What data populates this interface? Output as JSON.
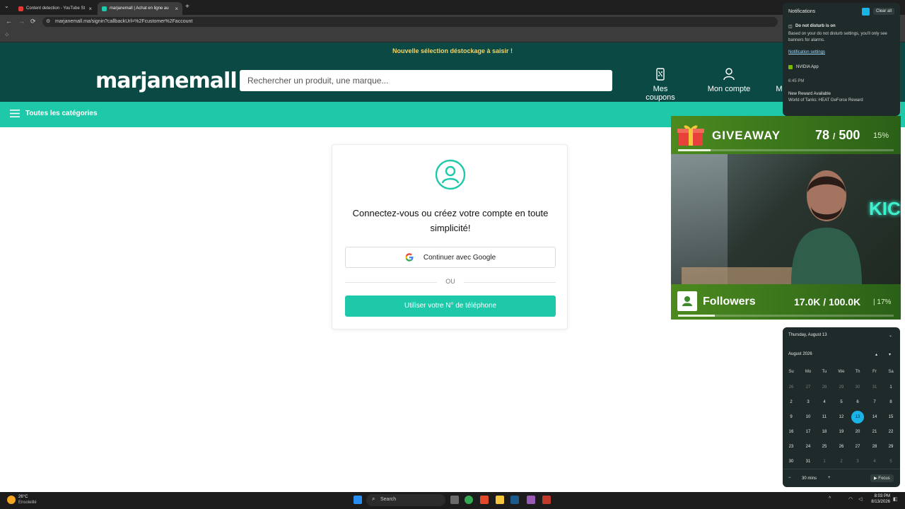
{
  "browser": {
    "tabs": [
      {
        "title": "Content detection - YouTube St",
        "active": false
      },
      {
        "title": "marjanemall | Achat en ligne au",
        "active": true
      }
    ],
    "new_tab": "+",
    "url": "marjanemall.ma/signin?callbackUrl=%2Fcustomer%2Faccount"
  },
  "site": {
    "promo": "Nouvelle sélection déstockage à saisir !",
    "logo": "marjanemall",
    "search_placeholder": "Rechercher un produit, une marque...",
    "header_items": {
      "coupons": "Mes coupons",
      "account": "Mon compte",
      "more": "M"
    },
    "categories": "Toutes les catégories"
  },
  "login": {
    "title": "Connectez-vous ou créez votre compte en toute simplicité!",
    "google": "Continuer avec Google",
    "or": "OU",
    "phone": "Utiliser votre N° de téléphone"
  },
  "notifications": {
    "header": "Notifications",
    "clear": "Clear all",
    "dnd_title": "Do not disturb is on",
    "dnd_body": "Based on your do not disturb settings, you'll only see banners for alarms.",
    "settings_link": "Notification settings",
    "app": "NVIDIA App",
    "time": "6:45 PM",
    "reward_title": "New Reward Available",
    "reward_body": "World of Tanks: HEAT GeForce Reward"
  },
  "overlay": {
    "giveaway_label": "GIVEAWAY",
    "giveaway_count": "78",
    "giveaway_sep": "/",
    "giveaway_total": "500",
    "giveaway_pct": "15%",
    "giveaway_progress": 0.15,
    "followers_label": "Followers",
    "followers_count": "17.0K / 100.0K",
    "followers_pct": "| 17%",
    "followers_progress": 0.17,
    "webcam_sign": "KICK"
  },
  "calendar": {
    "date_header": "Thursday, August 13",
    "month": "August 2026",
    "dow": [
      "Su",
      "Mo",
      "Tu",
      "We",
      "Th",
      "Fr",
      "Sa"
    ],
    "weeks": [
      [
        "26",
        "27",
        "28",
        "29",
        "30",
        "31",
        "1"
      ],
      [
        "2",
        "3",
        "4",
        "5",
        "6",
        "7",
        "8"
      ],
      [
        "9",
        "10",
        "11",
        "12",
        "13",
        "14",
        "15"
      ],
      [
        "16",
        "17",
        "18",
        "19",
        "20",
        "21",
        "22"
      ],
      [
        "23",
        "24",
        "25",
        "26",
        "27",
        "28",
        "29"
      ],
      [
        "30",
        "31",
        "1",
        "2",
        "3",
        "4",
        "5"
      ]
    ],
    "today": "13",
    "focus_minutes": "30 mins",
    "focus_btn": "Focus"
  },
  "taskbar": {
    "weather_temp": "26°C",
    "weather_desc": "Ensoleillé",
    "search": "Search",
    "time": "8:03 PM",
    "date": "8/13/2026"
  },
  "colors": {
    "header_bg": "#0b4a44",
    "accent": "#1ec9a9",
    "promo_text": "#f3d46b",
    "overlay_green": "#4c8a1f",
    "today_blue": "#1ab3e6"
  }
}
